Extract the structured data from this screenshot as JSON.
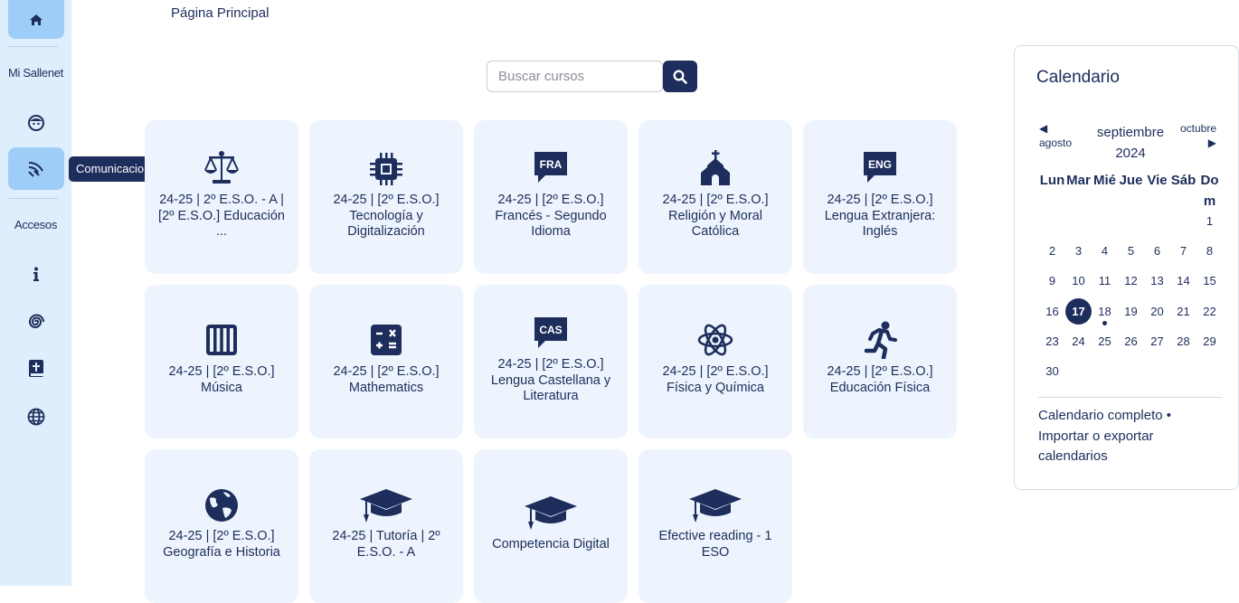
{
  "sidebar": {
    "home_icon": "home-icon",
    "mi_sallenet": "Mi Sallenet",
    "accesos": "Accesos",
    "tooltip": "Comunicaciones",
    "icons": [
      "face-icon",
      "broadcast-icon",
      "info-icon",
      "spiral-icon",
      "bible-icon",
      "globe-icon"
    ]
  },
  "breadcrumb": "Página Principal",
  "search": {
    "placeholder": "Buscar cursos"
  },
  "courses": [
    {
      "title": "24-25 | 2º E.S.O. - A | [2º E.S.O.] Educación ...",
      "icon": "scale-icon"
    },
    {
      "title": "24-25 | [2º E.S.O.] Tecnología y Digitalización",
      "icon": "microchip-icon"
    },
    {
      "title": "24-25 | [2º E.S.O.] Francés - Segundo Idioma",
      "icon": "fra-language-icon",
      "icon_text": "FRA"
    },
    {
      "title": "24-25 | [2º E.S.O.] Religión y Moral Católica",
      "icon": "church-icon"
    },
    {
      "title": "24-25 | [2º E.S.O.] Lengua Extranjera: Inglés",
      "icon": "eng-language-icon",
      "icon_text": "ENG"
    },
    {
      "title": "24-25 | [2º E.S.O.] Música",
      "icon": "piano-icon"
    },
    {
      "title": "24-25 | [2º E.S.O.] Mathematics",
      "icon": "calculator-icon"
    },
    {
      "title": "24-25 | [2º E.S.O.] Lengua Castellana y Literatura",
      "icon": "cas-language-icon",
      "icon_text": "CAS"
    },
    {
      "title": "24-25 | [2º E.S.O.] Física y Química",
      "icon": "atom-icon"
    },
    {
      "title": "24-25 | [2º E.S.O.] Educación Física",
      "icon": "running-icon"
    },
    {
      "title": "24-25 | [2º E.S.O.] Geografía e Historia",
      "icon": "earth-icon"
    },
    {
      "title": "24-25 | Tutoría | 2º E.S.O. - A",
      "icon": "graduation-cap-icon"
    },
    {
      "title": "Competencia Digital",
      "icon": "graduation-cap-icon"
    },
    {
      "title": "Efective reading - 1 ESO",
      "icon": "graduation-cap-icon"
    }
  ],
  "calendar": {
    "title": "Calendario",
    "prev_month": "agosto",
    "prev_arrow": "◀",
    "next_month": "octubre",
    "next_arrow": "▶",
    "month_line1": "septiembre",
    "month_line2": "2024",
    "weekdays": [
      "Lun",
      "Mar",
      "Mié",
      "Jue",
      "Vie",
      "Sáb",
      "Dom"
    ],
    "today": "17",
    "event_day": "18",
    "weeks": [
      [
        "",
        "",
        "",
        "",
        "",
        "",
        "1"
      ],
      [
        "2",
        "3",
        "4",
        "5",
        "6",
        "7",
        "8"
      ],
      [
        "9",
        "10",
        "11",
        "12",
        "13",
        "14",
        "15"
      ],
      [
        "16",
        "17",
        "18",
        "19",
        "20",
        "21",
        "22"
      ],
      [
        "23",
        "24",
        "25",
        "26",
        "27",
        "28",
        "29"
      ],
      [
        "30",
        "",
        "",
        "",
        "",
        "",
        ""
      ]
    ],
    "full_link": "Calendario completo",
    "bullet": "•",
    "export_link": "Importar o exportar calendarios"
  },
  "colors": {
    "primary": "#1d2d5c",
    "sidebar_bg": "#deeefc",
    "sidebar_active": "#9ecdf8",
    "card_bg": "#edf4fd"
  }
}
